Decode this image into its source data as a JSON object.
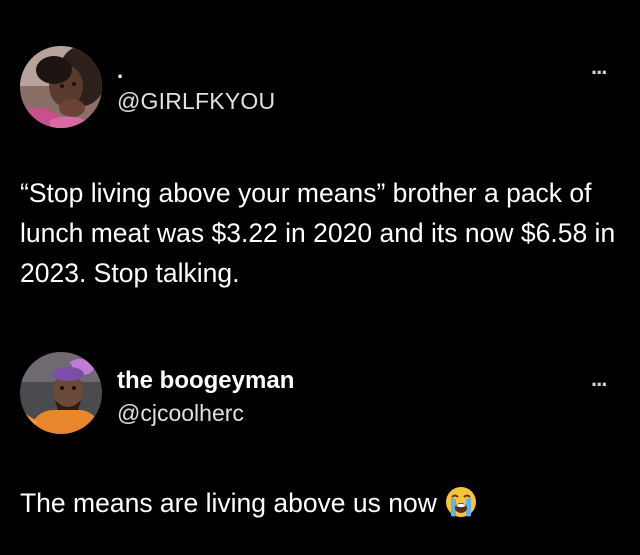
{
  "posts": [
    {
      "display_name": ".",
      "handle": "@GIRLFKYOU",
      "more_label": "...",
      "text": "“Stop living above your means” brother a pack of lunch meat was $3.22 in 2020 and its now $6.58 in 2023. Stop talking.",
      "avatar_icon": "profile-photo"
    },
    {
      "display_name": "the boogeyman",
      "handle": "@cjcoolherc",
      "more_label": "...",
      "text": "The means are living above us now",
      "emoji": "loudly-crying-face-emoji",
      "avatar_icon": "profile-photo"
    }
  ],
  "colors": {
    "background": "#000000",
    "text": "#ffffff",
    "handle": "#e0e0e0",
    "emoji": "#f7c43b"
  }
}
